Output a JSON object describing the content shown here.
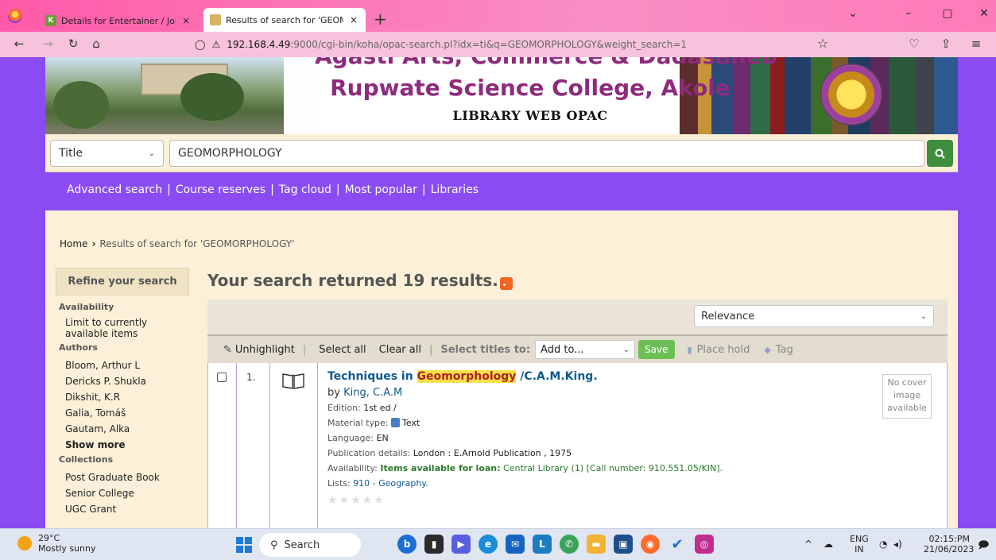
{
  "browser": {
    "tabs": [
      {
        "title": "Details for Entertainer / John Ol",
        "close": "×"
      },
      {
        "title": "Results of search for 'GEOMORI",
        "close": "×"
      }
    ],
    "new_tab": "+",
    "url_host": "192.168.4.49",
    "url_rest": ":9000/cgi-bin/koha/opac-search.pl?idx=ti&q=GEOMORPHOLOGY&weight_search=1"
  },
  "banner": {
    "line1": "Agasti Arts, Commerce & Dadasaheb",
    "college": "Rupwate Science College, Akole",
    "subtitle": "LIBRARY WEB OPAC"
  },
  "search": {
    "index_label": "Title",
    "query": "GEOMORPHOLOGY",
    "button_icon": "search-icon"
  },
  "links": [
    "Advanced search",
    "Course reserves",
    "Tag cloud",
    "Most popular",
    "Libraries"
  ],
  "breadcrumb": {
    "home": "Home",
    "current": "Results of search for 'GEOMORPHOLOGY'"
  },
  "refine": {
    "heading": "Refine your search",
    "availability_label": "Availability",
    "availability_item": "Limit to currently available items",
    "authors_label": "Authors",
    "authors": [
      "Bloom, Arthur L",
      "Dericks P. Shukla",
      "Dikshit, K.R",
      "Galia, Tomáš",
      "Gautam, Alka"
    ],
    "show_more": "Show more",
    "collections_label": "Collections",
    "collections": [
      "Post Graduate Book",
      "Senior College",
      "UGC Grant"
    ]
  },
  "results": {
    "summary": "Your search returned 19 results.",
    "sort_value": "Relevance",
    "toolbar": {
      "unhighlight": "Unhighlight",
      "select_all": "Select all",
      "clear_all": "Clear all",
      "select_titles": "Select titles to:",
      "add_to": "Add to...",
      "save": "Save",
      "place_hold": "Place hold",
      "tag": "Tag"
    },
    "items": [
      {
        "number": "1.",
        "title_pre": "Techniques in ",
        "title_hl": "Geomorphology",
        "title_post": " /C.A.M.King.",
        "by_label": "by",
        "author": "King, C.A.M",
        "edition_label": "Edition:",
        "edition": "1st ed /",
        "material_label": "Material type:",
        "material": "Text",
        "language_label": "Language:",
        "language": "EN",
        "pub_label": "Publication details:",
        "pub": "London : E.Arnold Publication , 1975",
        "avail_label": "Availability:",
        "avail_ok": "Items available for loan:",
        "avail_loc": "Central Library (1) [Call number: 910.551.05/KIN].",
        "lists_label": "Lists:",
        "lists": "910 - Geography.",
        "no_cover": "No cover image available"
      }
    ]
  },
  "taskbar": {
    "temp": "29°C",
    "weather": "Mostly sunny",
    "search": "Search",
    "lang1": "ENG",
    "lang2": "IN",
    "time": "02:15:PM",
    "date": "21/06/2023"
  }
}
